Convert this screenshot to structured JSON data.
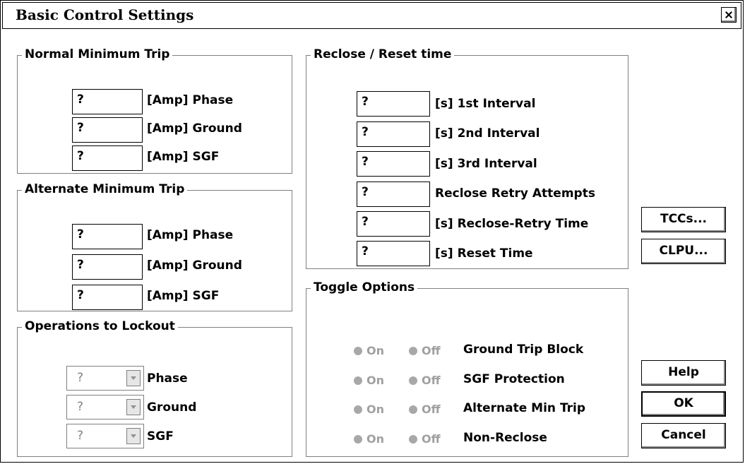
{
  "window": {
    "title": "Basic Control Settings"
  },
  "normal_min_trip": {
    "legend": "Normal Minimum Trip",
    "rows": [
      {
        "value": "?",
        "label": "[Amp] Phase"
      },
      {
        "value": "?",
        "label": "[Amp] Ground"
      },
      {
        "value": "?",
        "label": "[Amp] SGF"
      }
    ]
  },
  "alternate_min_trip": {
    "legend": "Alternate Minimum Trip",
    "rows": [
      {
        "value": "?",
        "label": "[Amp] Phase"
      },
      {
        "value": "?",
        "label": "[Amp] Ground"
      },
      {
        "value": "?",
        "label": "[Amp] SGF"
      }
    ]
  },
  "operations_to_lockout": {
    "legend": "Operations to Lockout",
    "rows": [
      {
        "value": "?",
        "label": "Phase"
      },
      {
        "value": "?",
        "label": "Ground"
      },
      {
        "value": "?",
        "label": "SGF"
      }
    ]
  },
  "reclose_reset": {
    "legend": "Reclose / Reset time",
    "rows": [
      {
        "value": "?",
        "label": "[s] 1st Interval"
      },
      {
        "value": "?",
        "label": "[s] 2nd Interval"
      },
      {
        "value": "?",
        "label": "[s] 3rd Interval"
      },
      {
        "value": "?",
        "label": "Reclose Retry Attempts"
      },
      {
        "value": "?",
        "label": "[s] Reclose-Retry Time"
      },
      {
        "value": "?",
        "label": "[s] Reset Time"
      }
    ]
  },
  "toggle_options": {
    "legend": "Toggle Options",
    "on_label": "On",
    "off_label": "Off",
    "rows": [
      {
        "label": "Ground Trip Block"
      },
      {
        "label": "SGF Protection"
      },
      {
        "label": "Alternate Min Trip"
      },
      {
        "label": "Non-Reclose"
      }
    ]
  },
  "buttons": {
    "tccs": "TCCs...",
    "clpu": "CLPU...",
    "help": "Help",
    "ok": "OK",
    "cancel": "Cancel"
  }
}
